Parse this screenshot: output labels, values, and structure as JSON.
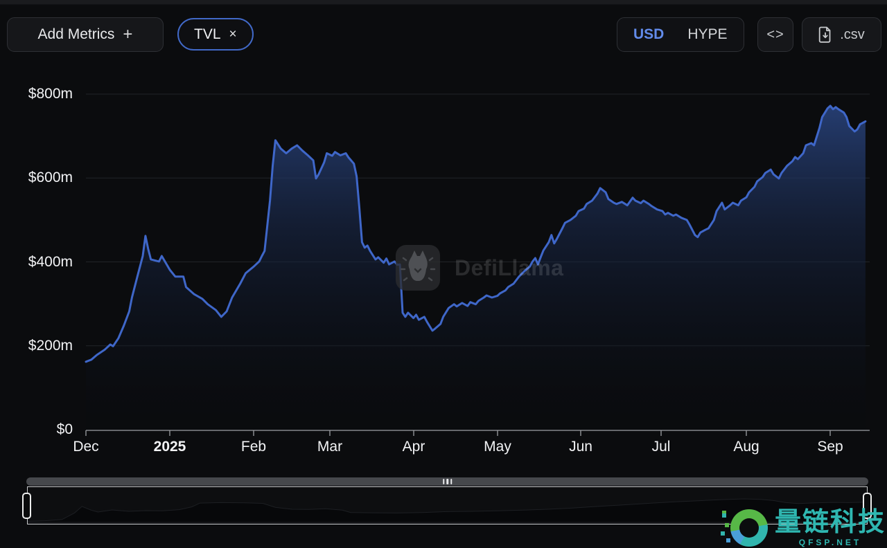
{
  "header": {
    "add_metrics_label": "Add Metrics",
    "plus_icon": "+",
    "metric_chip": {
      "label": "TVL",
      "close_icon": "×"
    },
    "currency_toggle": {
      "options": [
        {
          "label": "USD",
          "active": true
        },
        {
          "label": "HYPE",
          "active": false
        }
      ]
    },
    "embed_button_label": "<>",
    "csv_button_label": ".csv"
  },
  "watermark": {
    "brand": "DefiLlama"
  },
  "site_watermark": {
    "name": "量链科技",
    "domain": "QFSP.NET"
  },
  "colors": {
    "background": "#0b0c0e",
    "line": "#3f67c9",
    "area_top": "#2b4784",
    "accent_blue": "#4169c8",
    "usd_active": "#628bea",
    "axis": "#9da0a4",
    "grid": "#222428",
    "watermark_teal": "#2fb7b1"
  },
  "chart_data": {
    "type": "area",
    "metric": "TVL",
    "currency": "USD",
    "x_unit": "days since 2024-12-01",
    "x_tick_labels": [
      "Dec",
      "2025",
      "Feb",
      "Mar",
      "Apr",
      "May",
      "Jun",
      "Jul",
      "Aug",
      "Sep"
    ],
    "x_tick_bold": [
      false,
      true,
      false,
      false,
      false,
      false,
      false,
      false,
      false,
      false
    ],
    "y_tick_labels": [
      "$800m",
      "$600m",
      "$400m",
      "$200m",
      "$0"
    ],
    "y_tick_values": [
      800,
      600,
      400,
      200,
      0
    ],
    "ylim": [
      0,
      800
    ],
    "y_unit": "USD millions",
    "grid": "horizontal",
    "legend": "none",
    "series": [
      {
        "name": "TVL",
        "unit": "$m",
        "points": [
          [
            0,
            162
          ],
          [
            2,
            167
          ],
          [
            4,
            178
          ],
          [
            7,
            191
          ],
          [
            9,
            203
          ],
          [
            10,
            199
          ],
          [
            12,
            218
          ],
          [
            14,
            248
          ],
          [
            16,
            282
          ],
          [
            17,
            315
          ],
          [
            19,
            365
          ],
          [
            21,
            414
          ],
          [
            22,
            462
          ],
          [
            23,
            431
          ],
          [
            24,
            406
          ],
          [
            27,
            401
          ],
          [
            28,
            414
          ],
          [
            31,
            381
          ],
          [
            33,
            365
          ],
          [
            36,
            365
          ],
          [
            37,
            340
          ],
          [
            40,
            323
          ],
          [
            43,
            312
          ],
          [
            45,
            299
          ],
          [
            48,
            285
          ],
          [
            50,
            269
          ],
          [
            52,
            282
          ],
          [
            54,
            315
          ],
          [
            57,
            348
          ],
          [
            59,
            373
          ],
          [
            62,
            389
          ],
          [
            64,
            401
          ],
          [
            65,
            414
          ],
          [
            66,
            426
          ],
          [
            68,
            546
          ],
          [
            69,
            629
          ],
          [
            70,
            690
          ],
          [
            72,
            670
          ],
          [
            74,
            659
          ],
          [
            76,
            670
          ],
          [
            78,
            678
          ],
          [
            80,
            665
          ],
          [
            82,
            654
          ],
          [
            84,
            642
          ],
          [
            85,
            599
          ],
          [
            86,
            609
          ],
          [
            88,
            637
          ],
          [
            89,
            659
          ],
          [
            91,
            653
          ],
          [
            92,
            662
          ],
          [
            94,
            654
          ],
          [
            96,
            659
          ],
          [
            97,
            649
          ],
          [
            99,
            634
          ],
          [
            100,
            604
          ],
          [
            101,
            530
          ],
          [
            102,
            447
          ],
          [
            103,
            434
          ],
          [
            104,
            439
          ],
          [
            105,
            426
          ],
          [
            107,
            406
          ],
          [
            108,
            411
          ],
          [
            110,
            398
          ],
          [
            111,
            408
          ],
          [
            112,
            394
          ],
          [
            114,
            401
          ],
          [
            115,
            393
          ],
          [
            116,
            394
          ],
          [
            117,
            279
          ],
          [
            118,
            269
          ],
          [
            119,
            279
          ],
          [
            121,
            266
          ],
          [
            122,
            274
          ],
          [
            123,
            262
          ],
          [
            125,
            269
          ],
          [
            126,
            257
          ],
          [
            128,
            236
          ],
          [
            129,
            241
          ],
          [
            131,
            252
          ],
          [
            132,
            269
          ],
          [
            134,
            290
          ],
          [
            136,
            299
          ],
          [
            137,
            294
          ],
          [
            139,
            302
          ],
          [
            141,
            295
          ],
          [
            142,
            304
          ],
          [
            144,
            299
          ],
          [
            145,
            307
          ],
          [
            147,
            315
          ],
          [
            148,
            320
          ],
          [
            150,
            315
          ],
          [
            152,
            319
          ],
          [
            153,
            325
          ],
          [
            155,
            332
          ],
          [
            156,
            340
          ],
          [
            158,
            348
          ],
          [
            160,
            365
          ],
          [
            162,
            378
          ],
          [
            164,
            389
          ],
          [
            165,
            401
          ],
          [
            166,
            409
          ],
          [
            167,
            394
          ],
          [
            168,
            411
          ],
          [
            169,
            427
          ],
          [
            171,
            447
          ],
          [
            172,
            464
          ],
          [
            173,
            444
          ],
          [
            174,
            455
          ],
          [
            176,
            480
          ],
          [
            177,
            493
          ],
          [
            179,
            500
          ],
          [
            181,
            510
          ],
          [
            182,
            521
          ],
          [
            184,
            527
          ],
          [
            185,
            538
          ],
          [
            187,
            546
          ],
          [
            189,
            563
          ],
          [
            190,
            576
          ],
          [
            192,
            566
          ],
          [
            193,
            550
          ],
          [
            195,
            541
          ],
          [
            196,
            538
          ],
          [
            198,
            543
          ],
          [
            200,
            535
          ],
          [
            202,
            553
          ],
          [
            203,
            546
          ],
          [
            205,
            540
          ],
          [
            206,
            546
          ],
          [
            208,
            538
          ],
          [
            209,
            533
          ],
          [
            211,
            525
          ],
          [
            213,
            521
          ],
          [
            214,
            513
          ],
          [
            215,
            517
          ],
          [
            217,
            510
          ],
          [
            218,
            513
          ],
          [
            220,
            505
          ],
          [
            222,
            500
          ],
          [
            223,
            489
          ],
          [
            225,
            464
          ],
          [
            226,
            459
          ],
          [
            227,
            470
          ],
          [
            229,
            477
          ],
          [
            230,
            480
          ],
          [
            232,
            500
          ],
          [
            233,
            521
          ],
          [
            235,
            541
          ],
          [
            236,
            525
          ],
          [
            238,
            535
          ],
          [
            239,
            541
          ],
          [
            241,
            535
          ],
          [
            242,
            546
          ],
          [
            244,
            554
          ],
          [
            245,
            566
          ],
          [
            247,
            579
          ],
          [
            248,
            592
          ],
          [
            250,
            602
          ],
          [
            251,
            612
          ],
          [
            253,
            620
          ],
          [
            254,
            609
          ],
          [
            256,
            599
          ],
          [
            257,
            612
          ],
          [
            259,
            629
          ],
          [
            261,
            640
          ],
          [
            262,
            650
          ],
          [
            263,
            645
          ],
          [
            265,
            659
          ],
          [
            266,
            678
          ],
          [
            268,
            683
          ],
          [
            269,
            678
          ],
          [
            271,
            719
          ],
          [
            272,
            745
          ],
          [
            274,
            766
          ],
          [
            275,
            772
          ],
          [
            276,
            764
          ],
          [
            277,
            769
          ],
          [
            278,
            764
          ],
          [
            280,
            756
          ],
          [
            281,
            745
          ],
          [
            282,
            724
          ],
          [
            284,
            711
          ],
          [
            285,
            716
          ],
          [
            286,
            728
          ],
          [
            288,
            735
          ]
        ]
      }
    ],
    "overview_series": {
      "name": "full-history-brush",
      "note": "normalized [x-fraction, height-fraction] silhouette in range selector",
      "points": [
        [
          0,
          0.05
        ],
        [
          0.02,
          0.07
        ],
        [
          0.04,
          0.12
        ],
        [
          0.055,
          0.4
        ],
        [
          0.064,
          0.68
        ],
        [
          0.075,
          0.52
        ],
        [
          0.083,
          0.44
        ],
        [
          0.1,
          0.53
        ],
        [
          0.12,
          0.47
        ],
        [
          0.14,
          0.5
        ],
        [
          0.16,
          0.49
        ],
        [
          0.18,
          0.54
        ],
        [
          0.195,
          0.66
        ],
        [
          0.205,
          0.82
        ],
        [
          0.23,
          0.84
        ],
        [
          0.26,
          0.83
        ],
        [
          0.28,
          0.81
        ],
        [
          0.295,
          0.64
        ],
        [
          0.315,
          0.56
        ],
        [
          0.335,
          0.55
        ],
        [
          0.355,
          0.58
        ],
        [
          0.375,
          0.52
        ],
        [
          0.385,
          0.42
        ],
        [
          0.41,
          0.41
        ],
        [
          0.44,
          0.4
        ],
        [
          0.47,
          0.42
        ],
        [
          0.5,
          0.46
        ],
        [
          0.53,
          0.47
        ],
        [
          0.56,
          0.49
        ],
        [
          0.59,
          0.52
        ],
        [
          0.62,
          0.56
        ],
        [
          0.65,
          0.61
        ],
        [
          0.68,
          0.68
        ],
        [
          0.71,
          0.74
        ],
        [
          0.74,
          0.81
        ],
        [
          0.77,
          0.87
        ],
        [
          0.8,
          0.92
        ],
        [
          0.83,
          0.97
        ],
        [
          0.855,
          1.0
        ],
        [
          0.875,
          0.98
        ],
        [
          0.89,
          0.93
        ],
        [
          0.905,
          0.84
        ],
        [
          0.92,
          0.8
        ],
        [
          0.94,
          0.83
        ],
        [
          0.96,
          0.85
        ],
        [
          0.98,
          0.84
        ],
        [
          1.0,
          0.86
        ]
      ]
    }
  }
}
